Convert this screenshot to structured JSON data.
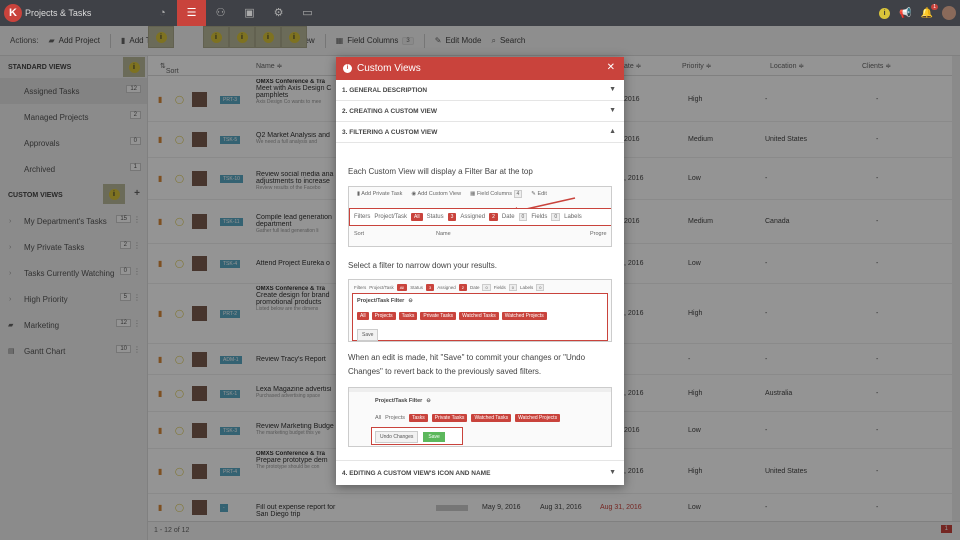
{
  "app": {
    "title": "Projects & Tasks",
    "logo": "K",
    "notif_count": "1",
    "info": "i"
  },
  "toolbar": {
    "actions": "Actions:",
    "add_project": "Add Project",
    "add_task": "Add Ta",
    "custom_view": "om View",
    "field_columns": "Field Columns",
    "field_columns_count": "3",
    "edit_mode": "Edit Mode",
    "search": "Search"
  },
  "hints": {
    "label": "i"
  },
  "sidebar": {
    "standard_title": "STANDARD VIEWS",
    "standard": [
      {
        "label": "Assigned Tasks",
        "count": "12"
      },
      {
        "label": "Managed Projects",
        "count": "2"
      },
      {
        "label": "Approvals",
        "count": "0"
      },
      {
        "label": "Archived",
        "count": "1"
      }
    ],
    "custom_title": "CUSTOM VIEWS",
    "add": "+",
    "custom": [
      {
        "label": "My Department's Tasks",
        "count": "15"
      },
      {
        "label": "My Private Tasks",
        "count": "2"
      },
      {
        "label": "Tasks Currently Watching",
        "count": "0"
      },
      {
        "label": "High Priority",
        "count": "5"
      },
      {
        "label": "Marketing",
        "count": "12"
      },
      {
        "label": "Gantt Chart",
        "count": "10"
      }
    ]
  },
  "table": {
    "headers": {
      "sort": "Sort",
      "name": "Name ≑",
      "date": "ate ≑",
      "priority": "Priority ≑",
      "location": "Location ≑",
      "clients": "Clients ≑"
    },
    "rows": [
      {
        "tag": "PRT-3",
        "group": "OMXS Conference & Tra",
        "title": "Meet with Axis Design C pamphlets",
        "desc": "Axis Design Co wants to mee",
        "date": "2016",
        "priority": "High",
        "location": "-",
        "clients": "-"
      },
      {
        "tag": "TSK-5",
        "group": "",
        "title": "Q2 Market Analysis and",
        "desc": "We need a full analysis and",
        "date": "2016",
        "priority": "Medium",
        "location": "United States",
        "clients": "-"
      },
      {
        "tag": "TSK-10",
        "group": "",
        "title": "Review social media ana adjustments to increase",
        "desc": "Review results of the Facebo",
        "date": ", 2016",
        "priority": "Low",
        "location": "-",
        "clients": "-"
      },
      {
        "tag": "TSK-11",
        "group": "",
        "title": "Compile lead generation department",
        "desc": "Gather full lead generation li",
        "date": "2016",
        "priority": "Medium",
        "location": "Canada",
        "clients": "-"
      },
      {
        "tag": "TSK-4",
        "group": "",
        "title": "Attend Project Eureka o",
        "desc": "",
        "date": ", 2016",
        "priority": "Low",
        "location": "-",
        "clients": "-"
      },
      {
        "tag": "PRT-2",
        "group": "OMXS Conference & Tra",
        "title": "Create design for brand promotional products",
        "desc": "Listed below are the dimens",
        "date": ", 2016",
        "priority": "High",
        "location": "-",
        "clients": "-"
      },
      {
        "tag": "ADM-1",
        "group": "",
        "title": "Review Tracy's Report",
        "desc": "",
        "date": "",
        "priority": "-",
        "location": "-",
        "clients": "-"
      },
      {
        "tag": "TSK-1",
        "group": "",
        "title": "Lexa Magazine advertisi",
        "desc": "Purchased advertising space",
        "date": ", 2016",
        "priority": "High",
        "location": "Australia",
        "clients": "-"
      },
      {
        "tag": "TSK-3",
        "group": "",
        "title": "Review Marketing Budge",
        "desc": "The marketing budget this ye",
        "date": "2016",
        "priority": "Low",
        "location": "-",
        "clients": "-"
      },
      {
        "tag": "PRT-4",
        "group": "OMXS Conference & Tra",
        "title": "Prepare prototype dem",
        "desc": "The prototype should be con",
        "date": ", 2016",
        "priority": "High",
        "location": "United States",
        "clients": "-"
      },
      {
        "tag": "-",
        "group": "",
        "title": "Fill out expense report for San Diego trip",
        "desc": "",
        "start": "May 9, 2016",
        "end": "Aug 31, 2016",
        "date": "Aug 31, 2016",
        "priority": "Low",
        "location": "-",
        "clients": "-"
      }
    ],
    "footer": "1 - 12 of 12",
    "page": "1"
  },
  "modal": {
    "title": "Custom Views",
    "close": "✕",
    "sections": [
      "1. GENERAL DESCRIPTION",
      "2. CREATING A CUSTOM VIEW",
      "3. FILTERING A CUSTOM VIEW"
    ],
    "section4": "4. EDITING A CUSTOM VIEW'S ICON AND NAME",
    "p1": "Each Custom View will display a Filter Bar at the top",
    "p2": "Select a filter to narrow down your results.",
    "p3": "When an edit is made, hit \"Save\" to commit your changes or \"Undo Changes\" to revert back to the previously saved filters.",
    "shot1": {
      "add_private": "Add Private Task",
      "add_view": "Add Custom View",
      "field_columns": "Field Columns",
      "fc_count": "4",
      "edit": "Edit",
      "filters": "Filters",
      "project_task": "Project/Task",
      "pt_badge": "All",
      "status": "Status",
      "status_n": "3",
      "assigned": "Assigned",
      "assigned_n": "2",
      "date": "Date",
      "date_n": "0",
      "fields": "Fields",
      "fields_n": "0",
      "labels": "Labels",
      "sort": "Sort",
      "name": "Name",
      "progress": "Progre"
    },
    "shot2": {
      "filters": "Filters",
      "project_task": "Project/Task",
      "pt_badge": "All",
      "status": "Status",
      "status_n": "3",
      "assigned": "Assigned",
      "assigned_n": "2",
      "date": "Date",
      "date_n": "0",
      "fields": "Fields",
      "fields_n": "0",
      "labels": "Labels",
      "labels_n": "0",
      "filter_title": "Project/Task Filter",
      "all": "All",
      "projects": "Projects",
      "tasks": "Tasks",
      "private": "Private Tasks",
      "watched_tasks": "Watched Tasks",
      "watched_projects": "Watched Projects",
      "save": "Save"
    },
    "shot3": {
      "filter_title": "Project/Task Filter",
      "all": "All",
      "projects": "Projects",
      "tasks": "Tasks",
      "private": "Private Tasks",
      "watched_tasks": "Watched Tasks",
      "watched_projects": "Watched Projects",
      "undo": "Undo Changes",
      "save": "Save"
    }
  },
  "colors": {
    "accent": "#c9433c",
    "topbar": "#3f4147",
    "tag": "#5aa9c4",
    "hint": "#d9c43a"
  }
}
